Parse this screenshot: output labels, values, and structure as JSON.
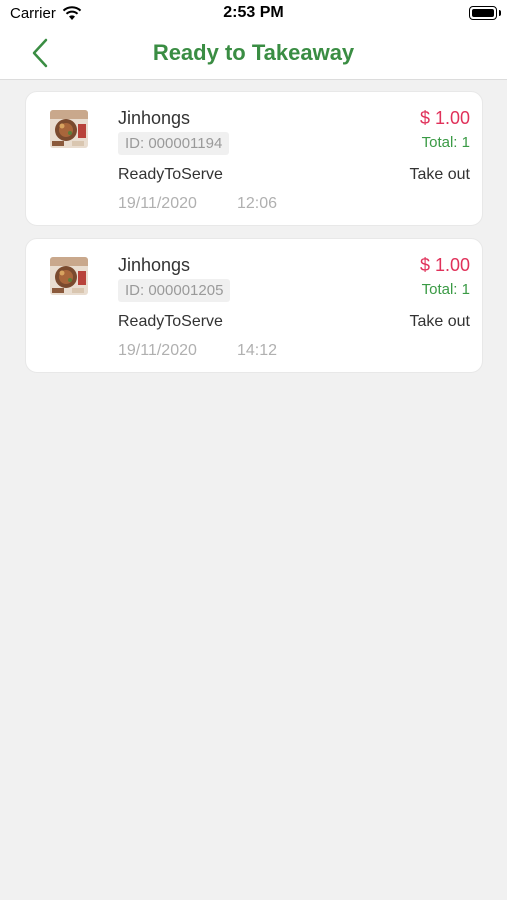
{
  "status_bar": {
    "carrier": "Carrier",
    "time": "2:53 PM"
  },
  "nav": {
    "title": "Ready to Takeaway",
    "back_icon": "chevron-left-icon"
  },
  "colors": {
    "accent": "#3a8d43",
    "price": "#e0315a",
    "total": "#3a9a45"
  },
  "orders": [
    {
      "name": "Jinhongs",
      "id": "ID: 000001194",
      "status": "ReadyToServe",
      "date": "19/11/2020",
      "time": "12:06",
      "price": "$ 1.00",
      "total": "Total: 1",
      "type": "Take out"
    },
    {
      "name": "Jinhongs",
      "id": "ID: 000001205",
      "status": "ReadyToServe",
      "date": "19/11/2020",
      "time": "14:12",
      "price": "$ 1.00",
      "total": "Total: 1",
      "type": "Take out"
    }
  ]
}
